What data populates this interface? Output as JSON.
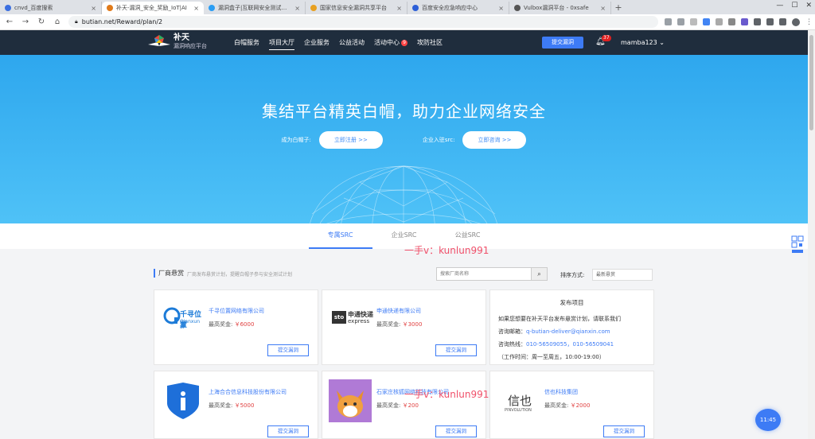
{
  "browser": {
    "tabs": [
      {
        "title": "cnvd_百度搜索",
        "color": "#3b6fe0",
        "active": false
      },
      {
        "title": "补天-漏洞_安全_奖励_IoT|AI",
        "color": "#e07a1a",
        "active": true
      },
      {
        "title": "漏洞盒子|互联网安全测试众测平",
        "color": "#2a9df4",
        "active": false
      },
      {
        "title": "国家信息安全漏洞共享平台",
        "color": "#e8a020",
        "active": false
      },
      {
        "title": "百度安全应急响应中心",
        "color": "#2c5fd8",
        "active": false
      },
      {
        "title": "Vulbox漏洞平台 - 0xsafe",
        "color": "#555555",
        "active": false
      }
    ],
    "new_tab": "+",
    "window_controls": [
      "—",
      "☐",
      "✕"
    ],
    "url": "butian.net/Reward/plan/2"
  },
  "header": {
    "logo_title": "补天",
    "logo_subtitle": "漏洞响应平台",
    "nav": [
      {
        "label": "白帽服务",
        "active": false
      },
      {
        "label": "项目大厅",
        "active": true
      },
      {
        "label": "企业服务",
        "active": false
      },
      {
        "label": "公益活动",
        "active": false
      },
      {
        "label": "活动中心",
        "active": false,
        "badge": "9"
      },
      {
        "label": "攻防社区",
        "active": false
      }
    ],
    "submit_label": "提交漏洞",
    "notification_count": "37",
    "username": "mamba123 ⌄"
  },
  "hero": {
    "title": "集结平台精英白帽，助力企业网络安全",
    "whitehat_prompt": "成为白帽子:",
    "register_label": "立即注册 >>",
    "enterprise_prompt": "企业入驻src:",
    "consult_label": "立即咨询 >>"
  },
  "src_tabs": [
    {
      "label": "专属SRC",
      "active": true
    },
    {
      "label": "企业SRC",
      "active": false
    },
    {
      "label": "公益SRC",
      "active": false
    }
  ],
  "watermarks": {
    "w1": "一手v：kunlun991",
    "w2": "一手v：kunlun991"
  },
  "filter": {
    "section_title": "厂商悬赏",
    "section_sub": "厂商发布悬赏计划，提醒白帽子参与安全测试计划",
    "search_placeholder": "搜索厂商名称",
    "sort_label": "排序方式:",
    "sort_value": "最新悬赏"
  },
  "cards": [
    {
      "name": "千寻位置网络有限公司",
      "reward_label": "最高奖金:",
      "reward": "￥6000",
      "button": "提交漏洞",
      "logo": "qianxun-logo"
    },
    {
      "name": "申通快递有限公司",
      "reward_label": "最高奖金:",
      "reward": "￥3000",
      "button": "提交漏洞",
      "logo": "sto-express-logo"
    },
    {
      "name": "上海合合信息科技股份有限公司",
      "reward_label": "最高奖金:",
      "reward": "￥5000",
      "button": "提交漏洞",
      "logo": "intsig-logo"
    },
    {
      "name": "石家庄核狐网络科技有限公司",
      "reward_label": "最高奖金:",
      "reward": "￥200",
      "button": "提交漏洞",
      "logo": "fox-cartoon-logo"
    },
    {
      "name": "信也科技集团",
      "reward_label": "最高奖金:",
      "reward": "￥2000",
      "button": "提交漏洞",
      "logo": "pinvolution-logo"
    }
  ],
  "info": {
    "title": "发布项目",
    "line1": "如果您想要在补天平台发布悬赏计划，请联系我们",
    "email_label": "咨询邮箱：",
    "email": "q-butian-deliver@qianxin.com",
    "phone_label": "咨询热线：",
    "phone": "010-56509055，010-56509041",
    "hours": "（工作时间：周一至周五，10:00-19:00）"
  },
  "logo_text": {
    "qianxun": "千寻位置",
    "qianxun_en": "Qianxun SI",
    "sto": "sto",
    "sto_cn": "申通快递",
    "sto_en": "express",
    "xinye": "信也",
    "xinye_en": "PINVOLUTION"
  },
  "clock": "11:45",
  "side_qr": "QR"
}
